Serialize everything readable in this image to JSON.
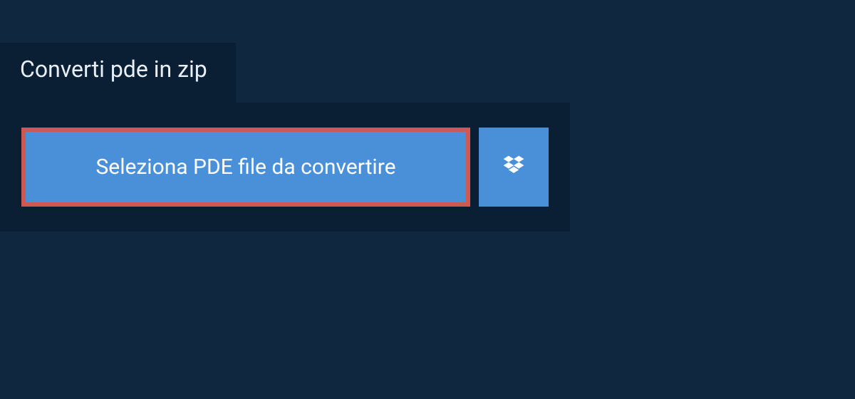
{
  "tab": {
    "label": "Converti pde in zip"
  },
  "actions": {
    "select_file_label": "Seleziona PDE file da convertire",
    "dropbox_icon": "dropbox"
  },
  "colors": {
    "background": "#0f2840",
    "panel": "#0a1f33",
    "button": "#4a90d9",
    "highlight_border": "#cc5a52",
    "text_light": "#e8eef5",
    "text_white": "#ffffff"
  }
}
